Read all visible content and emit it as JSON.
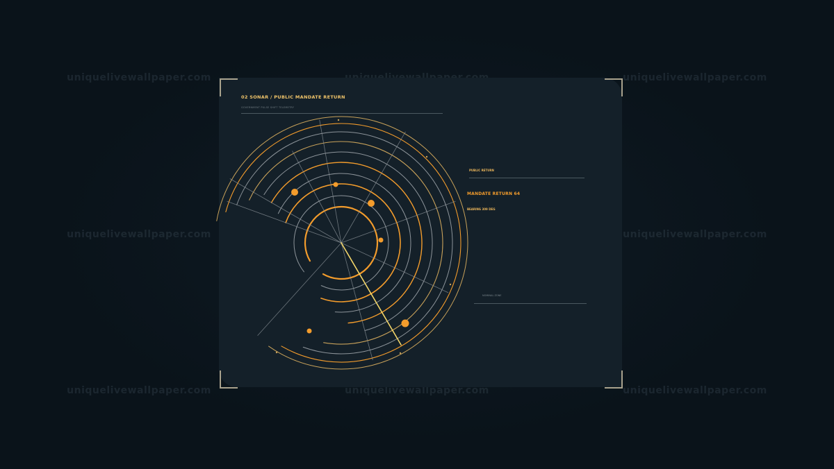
{
  "watermark": {
    "text": "uniquelivewallpaper.com"
  },
  "panel": {
    "title": "02  SONAR / PUBLIC MANDATE RETURN",
    "subtitle": "GOVERNMENT PULSE SHIFT TELEMETRY"
  },
  "readout": {
    "public_return_label": "PUBLIC RETURN",
    "mandate_return_label": "MANDATE RETURN  64",
    "bearing_label": "BEARING  309 DEG",
    "nominal_label": "NOMINAL ZONE"
  },
  "colors": {
    "background": "#0b141c",
    "panel": "#142029",
    "accent_orange": "#f39c2c",
    "accent_yellow": "#f0c46a",
    "grid_gray": "#8d949a",
    "corner_bracket": "#a9a28d"
  },
  "sonar": {
    "sweep_bearing_deg": 155,
    "contacts": 7
  }
}
